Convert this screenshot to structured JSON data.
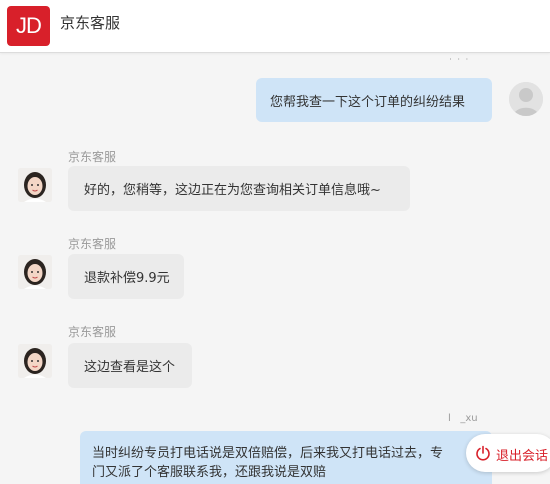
{
  "header": {
    "logo_text": "JD",
    "title": "京东客服"
  },
  "messages": [
    {
      "sender": "user",
      "name": "",
      "text": "您帮我查一下这个订单的纠纷结果"
    },
    {
      "sender": "agent",
      "name": "京东客服",
      "text": "好的，您稍等，这边正在为您查询相关订单信息哦~"
    },
    {
      "sender": "agent",
      "name": "京东客服",
      "text": "退款补偿9.9元"
    },
    {
      "sender": "agent",
      "name": "京东客服",
      "text": "这边查看是这个"
    },
    {
      "sender": "user",
      "name": "l   _xu",
      "text_line1": "当时纠纷专员打电话说是双倍赔偿，后来我又打电话过去，专",
      "text_line2": "门又派了个客服联系我，还跟我说是双赔"
    }
  ],
  "leave_button": {
    "label": "退出会话",
    "icon": "power-icon"
  },
  "colors": {
    "brand": "#d8202a",
    "agent_bubble": "#ebebeb",
    "user_bubble": "#cfe4f7"
  }
}
